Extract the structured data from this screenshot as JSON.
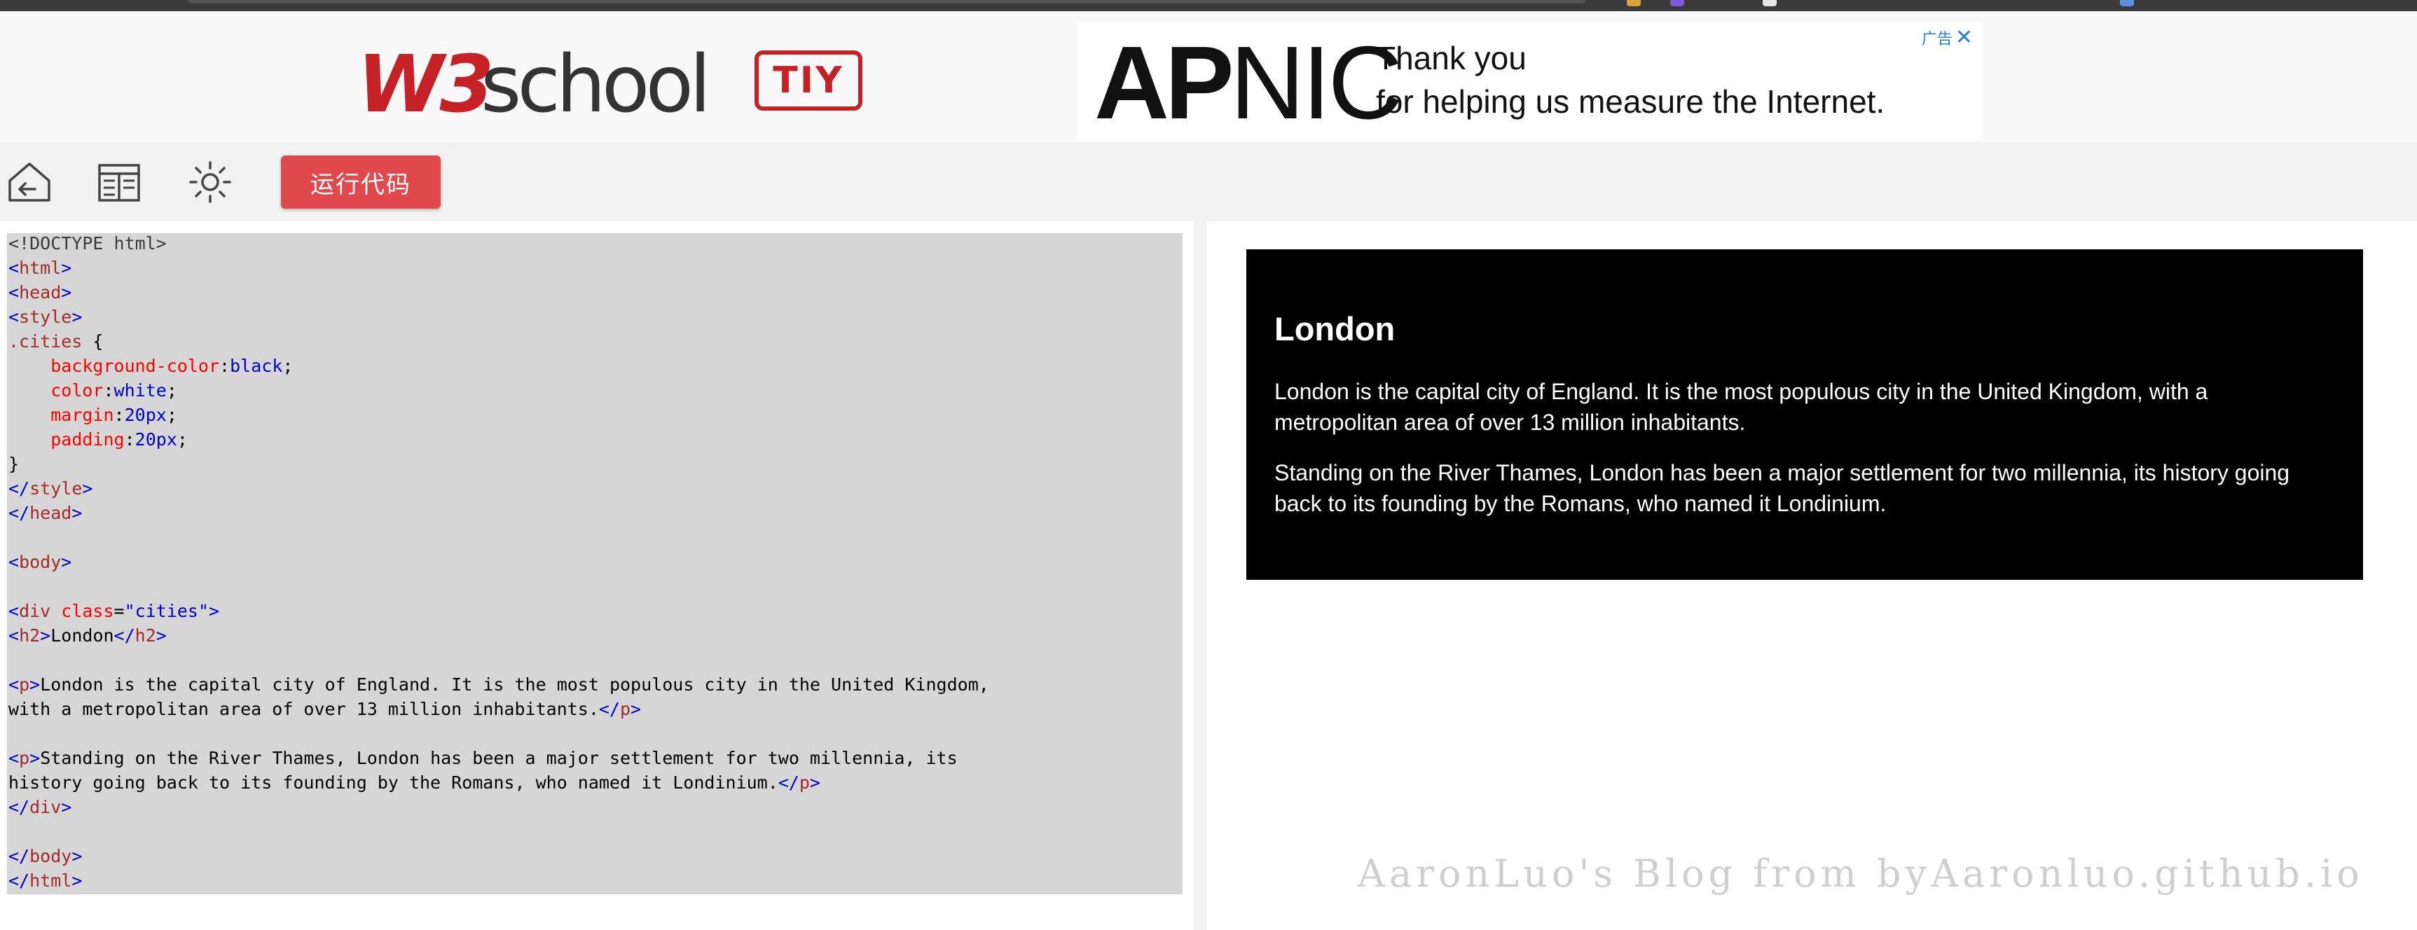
{
  "header": {
    "logo_w3": "W3",
    "logo_school": "school",
    "logo_badge": "TIY",
    "ad": {
      "logo_ap": "AP",
      "logo_nic": "NIC",
      "line1": "Thank you",
      "line2": "for helping us measure the Internet.",
      "ad_label": "广告"
    }
  },
  "toolbar": {
    "icons": [
      "home-back-icon",
      "layout-icon",
      "brightness-icon"
    ],
    "run_label": "运行代码"
  },
  "editor": {
    "lines": [
      "<!DOCTYPE html>",
      "<html>",
      "<head>",
      "<style>",
      ".cities {",
      "    background-color:black;",
      "    color:white;",
      "    margin:20px;",
      "    padding:20px;",
      "}",
      "</style>",
      "</head>",
      "",
      "<body>",
      "",
      "<div class=\"cities\">",
      "<h2>London</h2>",
      "",
      "<p>London is the capital city of England. It is the most populous city in the United Kingdom,",
      "with a metropolitan area of over 13 million inhabitants.</p>",
      "",
      "<p>Standing on the River Thames, London has been a major settlement for two millennia, its",
      "history going back to its founding by the Romans, who named it Londinium.</p>",
      "</div>",
      "",
      "</body>",
      "</html>"
    ]
  },
  "preview": {
    "heading": "London",
    "p1": "London is the capital city of England. It is the most populous city in the United Kingdom, with a metropolitan area of over 13 million inhabitants.",
    "p2": "Standing on the River Thames, London has been a major settlement for two millennia, its history going back to its founding by the Romans, who named it Londinium."
  },
  "watermark": "AaronLuo's Blog from byAaronluo.github.io",
  "colors": {
    "brand_red": "#c62126",
    "run_button": "#e04a4d",
    "editor_bg": "#d6d6d6",
    "tag_color": "#a52a2a",
    "bracket_color": "#0000cd",
    "property_color": "#ff0000"
  }
}
